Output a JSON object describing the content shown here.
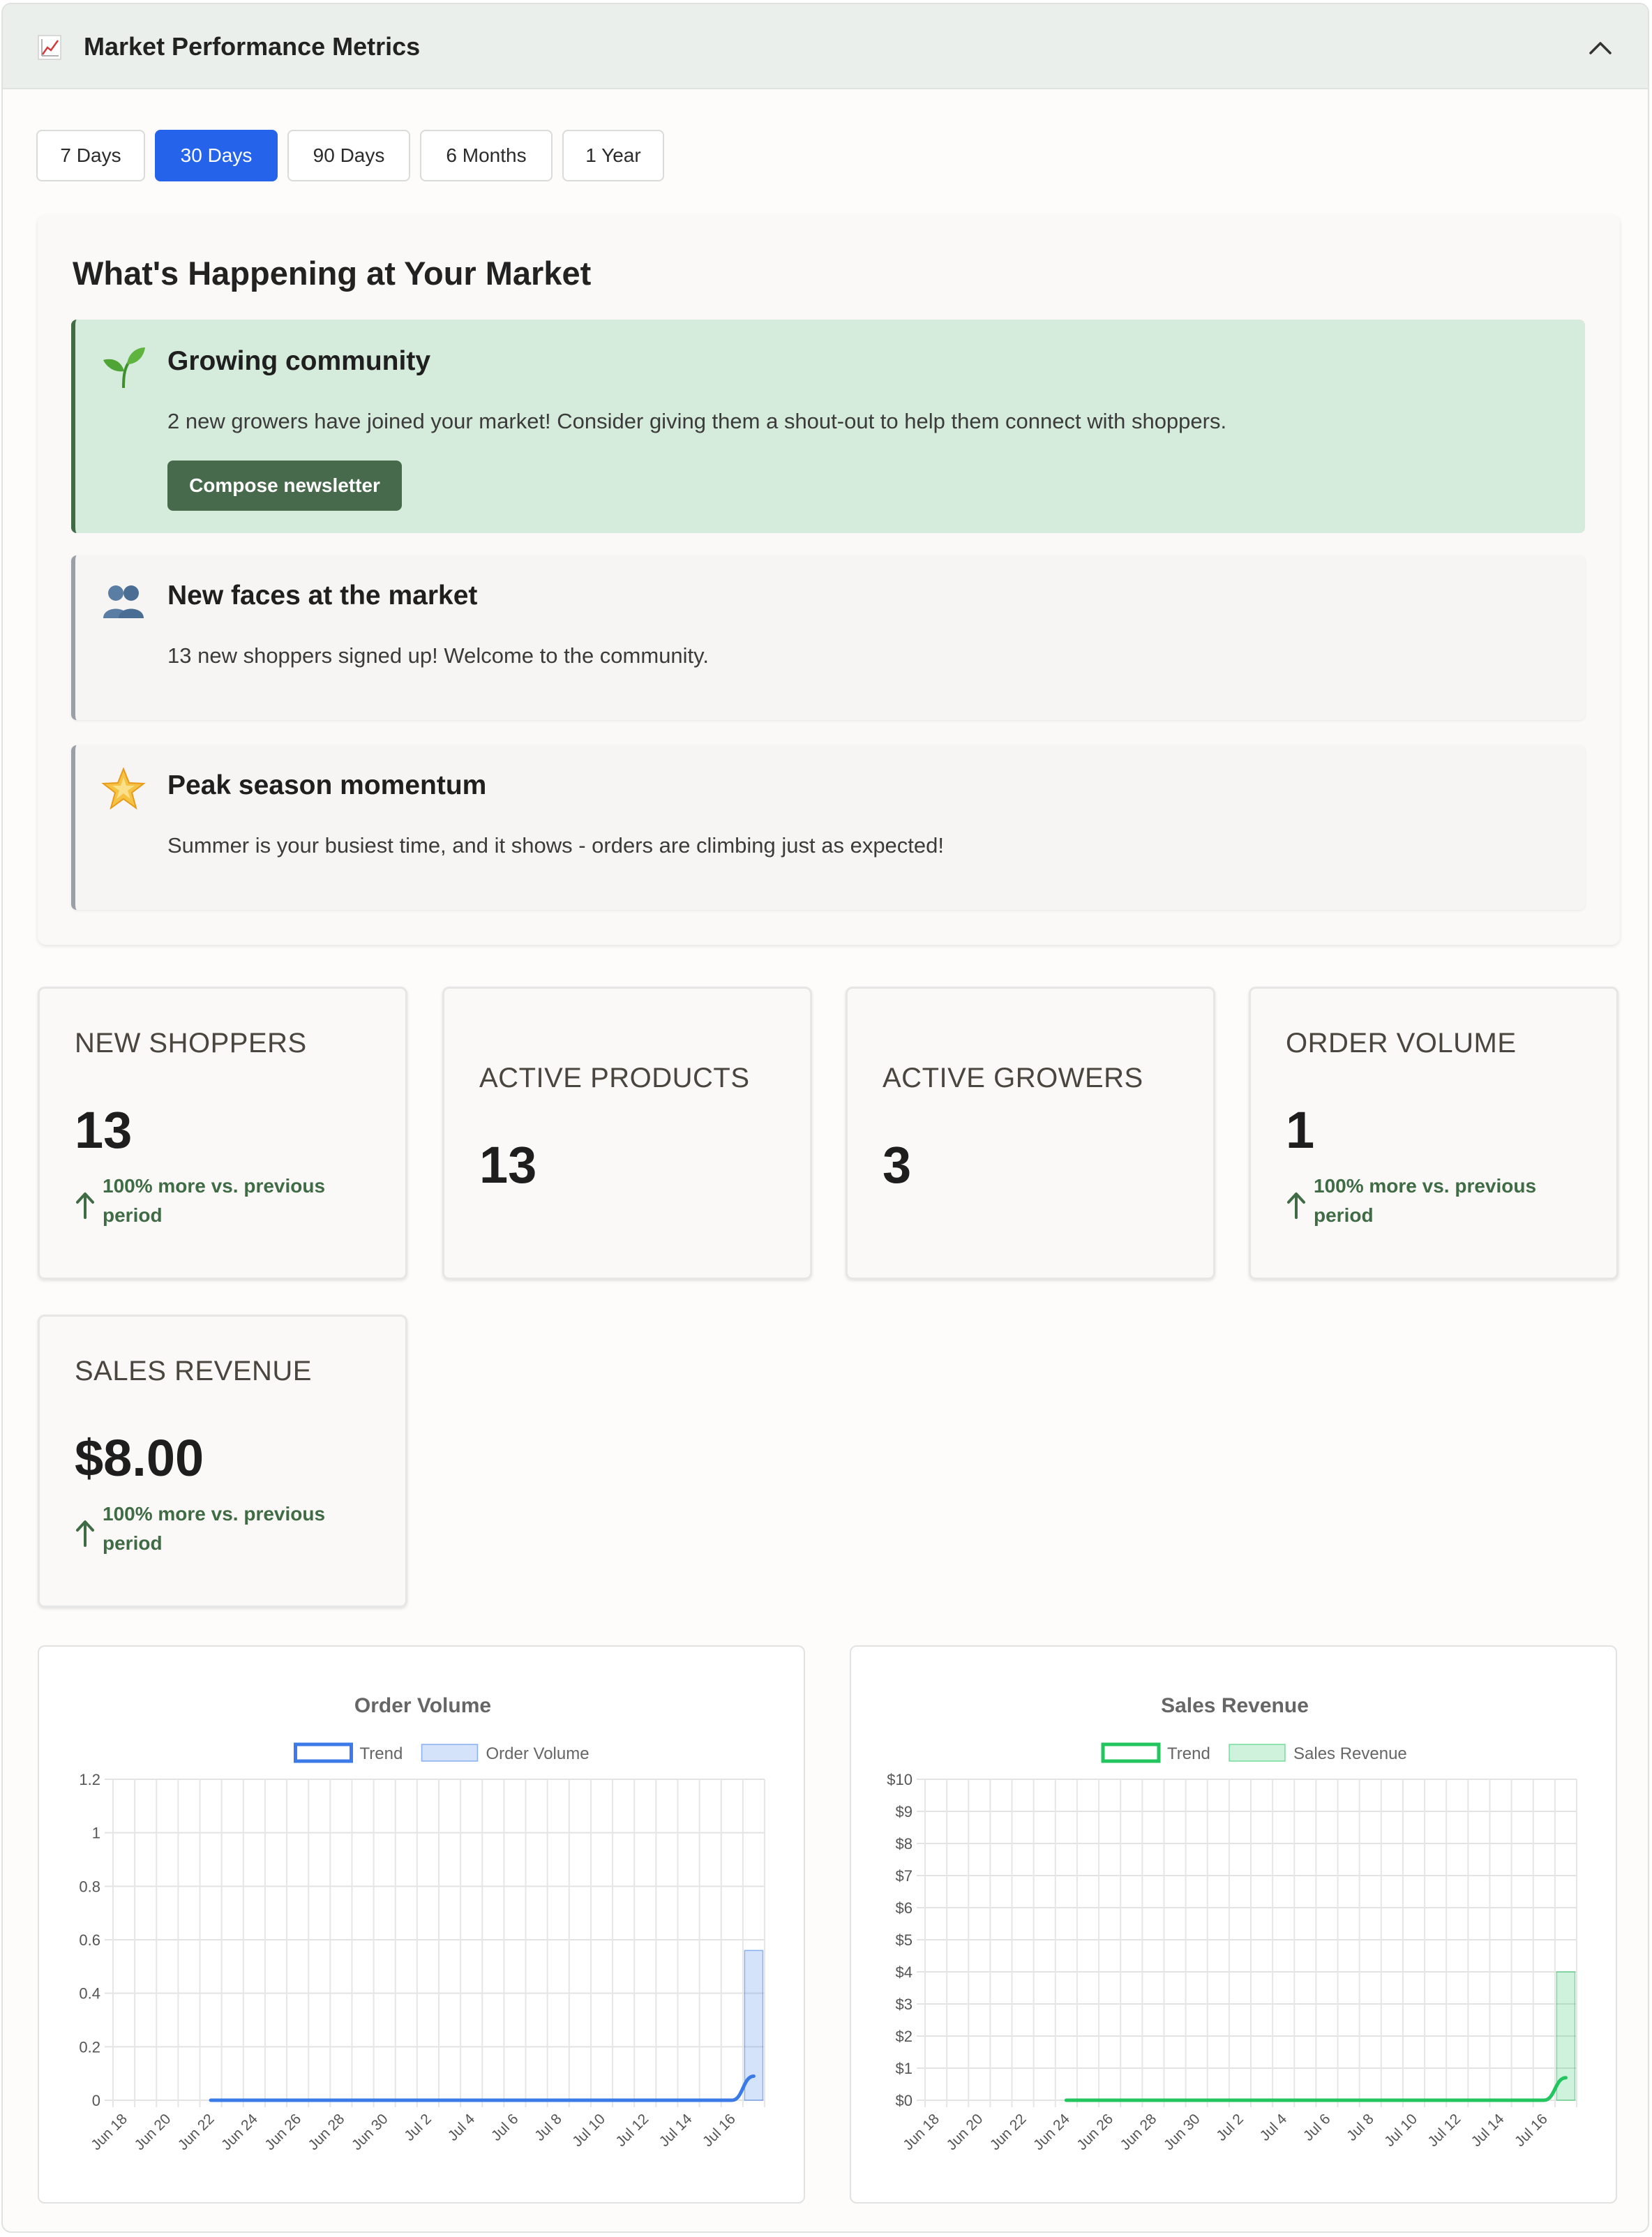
{
  "header": {
    "title": "Market Performance Metrics",
    "icon": "chart-trending-icon",
    "collapse_icon": "chevron-up-icon"
  },
  "period_tabs": {
    "items": [
      "7 Days",
      "30 Days",
      "90 Days",
      "6 Months",
      "1 Year"
    ],
    "active": "30 Days"
  },
  "happening": {
    "title": "What's Happening at Your Market",
    "notices": [
      {
        "icon": "seedling-icon",
        "title": "Growing community",
        "text": "2 new growers have joined your market! Consider giving them a shout-out to help them connect with shoppers.",
        "button": "Compose newsletter",
        "color": "#d5ebdb"
      },
      {
        "icon": "people-icon",
        "title": "New faces at the market",
        "text": "13 new shoppers signed up! Welcome to the community."
      },
      {
        "icon": "star-icon",
        "title": "Peak season momentum",
        "text": "Summer is your busiest time, and it shows - orders are climbing just as expected!"
      }
    ]
  },
  "metrics": [
    {
      "label": "NEW SHOPPERS",
      "value": "13",
      "trend": "100% more vs. previous period"
    },
    {
      "label": "ACTIVE PRODUCTS",
      "value": "13"
    },
    {
      "label": "ACTIVE GROWERS",
      "value": "3"
    },
    {
      "label": "ORDER VOLUME",
      "value": "1",
      "trend": "100% more vs. previous period"
    },
    {
      "label": "SALES REVENUE",
      "value": "$8.00",
      "trend": "100% more vs. previous period"
    }
  ],
  "colors": {
    "accent": "#2563eb",
    "growth": "#3f6b45",
    "order_line": "#3b7be8",
    "revenue_line": "#22c55e"
  },
  "chart_data": [
    {
      "type": "bar",
      "title": "Order Volume",
      "legend": [
        "Trend",
        "Order Volume"
      ],
      "legend_position": "top",
      "grid": true,
      "ylim": [
        0,
        1.2
      ],
      "yticks": [
        "0",
        "0.2",
        "0.4",
        "0.6",
        "0.8",
        "1",
        "1.2"
      ],
      "xticks": [
        "Jun 18",
        "Jun 20",
        "Jun 22",
        "Jun 24",
        "Jun 26",
        "Jun 28",
        "Jun 30",
        "Jul 2",
        "Jul 4",
        "Jul 6",
        "Jul 8",
        "Jul 10",
        "Jul 12",
        "Jul 14",
        "Jul 16"
      ],
      "categories": [
        "Jun 18",
        "Jun 19",
        "Jun 20",
        "Jun 21",
        "Jun 22",
        "Jun 23",
        "Jun 24",
        "Jun 25",
        "Jun 26",
        "Jun 27",
        "Jun 28",
        "Jun 29",
        "Jun 30",
        "Jul 1",
        "Jul 2",
        "Jul 3",
        "Jul 4",
        "Jul 5",
        "Jul 6",
        "Jul 7",
        "Jul 8",
        "Jul 9",
        "Jul 10",
        "Jul 11",
        "Jul 12",
        "Jul 13",
        "Jul 14",
        "Jul 15",
        "Jul 16",
        "Jul 17"
      ],
      "series": [
        {
          "name": "Order Volume",
          "kind": "bar",
          "values": [
            null,
            null,
            null,
            null,
            null,
            null,
            null,
            null,
            null,
            null,
            null,
            null,
            null,
            null,
            null,
            null,
            null,
            null,
            null,
            null,
            null,
            null,
            null,
            null,
            null,
            null,
            null,
            null,
            null,
            0.56
          ]
        },
        {
          "name": "Trend",
          "kind": "line",
          "values": [
            null,
            null,
            null,
            null,
            0,
            0,
            0,
            0,
            0,
            0,
            0,
            0,
            0,
            0,
            0,
            0,
            0,
            0,
            0,
            0,
            0,
            0,
            0,
            0,
            0,
            0,
            0,
            0,
            0,
            0.09
          ]
        }
      ]
    },
    {
      "type": "bar",
      "title": "Sales Revenue",
      "legend": [
        "Trend",
        "Sales Revenue"
      ],
      "legend_position": "top",
      "grid": true,
      "ylim": [
        0,
        10
      ],
      "yticks": [
        "$0",
        "$1",
        "$2",
        "$3",
        "$4",
        "$5",
        "$6",
        "$7",
        "$8",
        "$9",
        "$10"
      ],
      "xticks": [
        "Jun 18",
        "Jun 20",
        "Jun 22",
        "Jun 24",
        "Jun 26",
        "Jun 28",
        "Jun 30",
        "Jul 2",
        "Jul 4",
        "Jul 6",
        "Jul 8",
        "Jul 10",
        "Jul 12",
        "Jul 14",
        "Jul 16"
      ],
      "categories": [
        "Jun 18",
        "Jun 19",
        "Jun 20",
        "Jun 21",
        "Jun 22",
        "Jun 23",
        "Jun 24",
        "Jun 25",
        "Jun 26",
        "Jun 27",
        "Jun 28",
        "Jun 29",
        "Jun 30",
        "Jul 1",
        "Jul 2",
        "Jul 3",
        "Jul 4",
        "Jul 5",
        "Jul 6",
        "Jul 7",
        "Jul 8",
        "Jul 9",
        "Jul 10",
        "Jul 11",
        "Jul 12",
        "Jul 13",
        "Jul 14",
        "Jul 15",
        "Jul 16",
        "Jul 17"
      ],
      "series": [
        {
          "name": "Sales Revenue",
          "kind": "bar",
          "values": [
            null,
            null,
            null,
            null,
            null,
            null,
            null,
            null,
            null,
            null,
            null,
            null,
            null,
            null,
            null,
            null,
            null,
            null,
            null,
            null,
            null,
            null,
            null,
            null,
            null,
            null,
            null,
            null,
            null,
            4
          ]
        },
        {
          "name": "Trend",
          "kind": "line",
          "values": [
            null,
            null,
            null,
            null,
            null,
            null,
            0,
            0,
            0,
            0,
            0,
            0,
            0,
            0,
            0,
            0,
            0,
            0,
            0,
            0,
            0,
            0,
            0,
            0,
            0,
            0,
            0,
            0,
            0,
            0.7
          ]
        }
      ]
    }
  ]
}
